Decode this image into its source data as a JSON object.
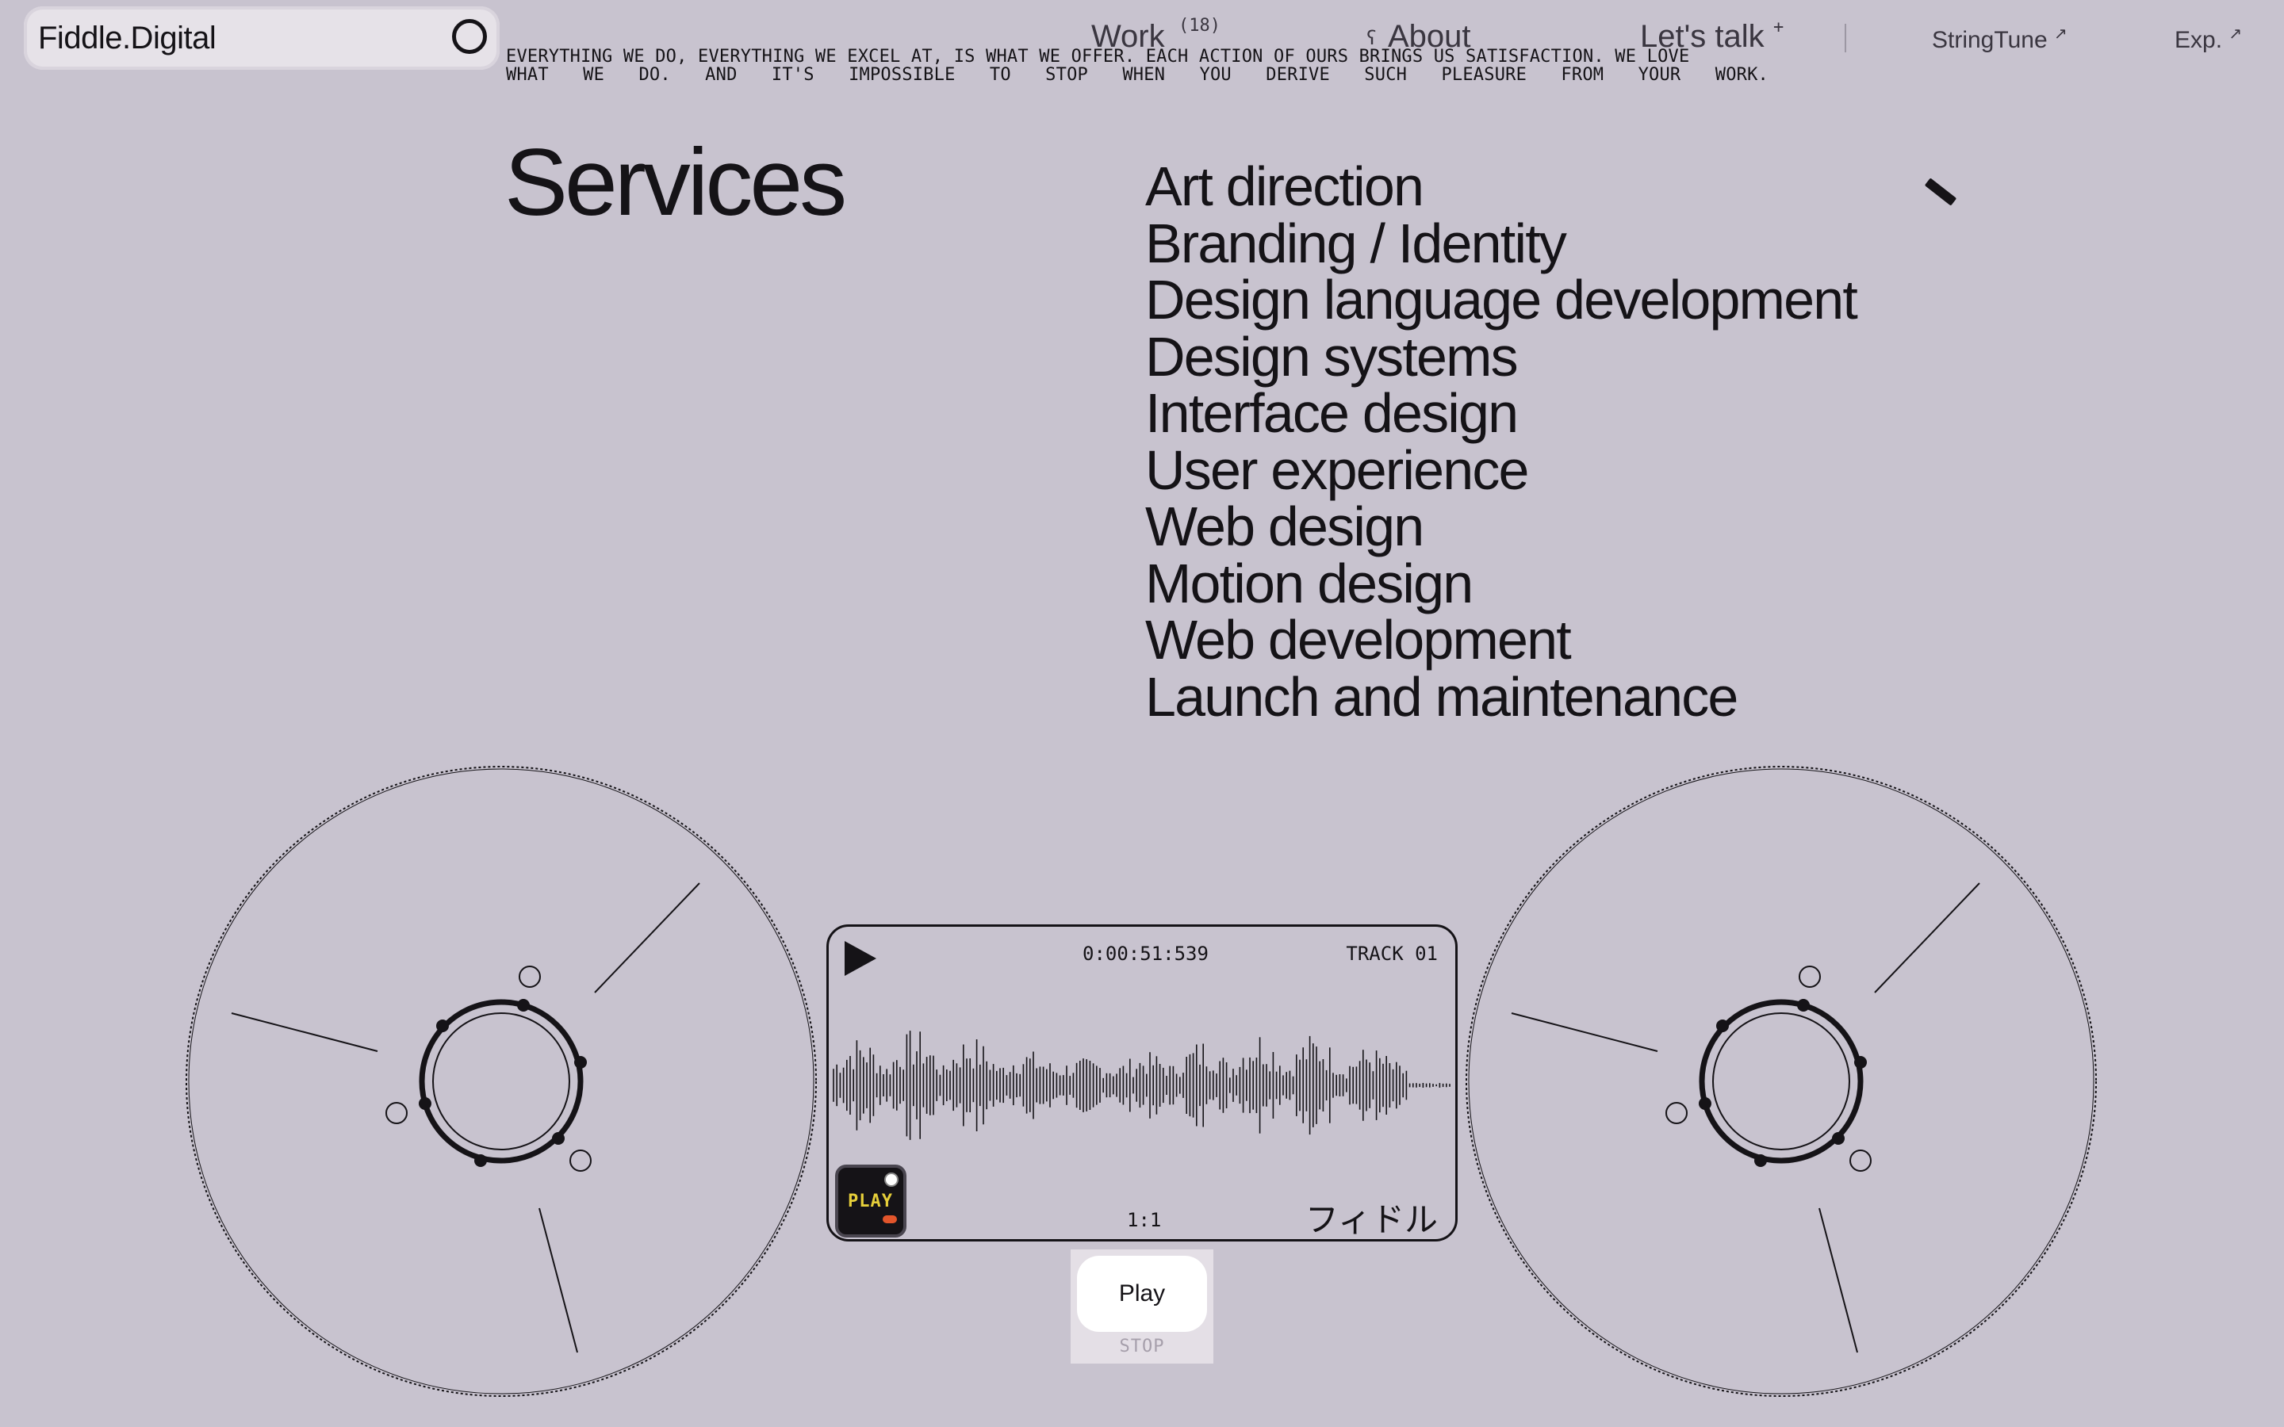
{
  "header": {
    "brand": "Fiddle.Digital",
    "nav": [
      {
        "label": "Work",
        "sup": "(18)"
      },
      {
        "label": "About",
        "prefix": "ʕ"
      },
      {
        "label": "Let's talk",
        "sup": "+"
      }
    ],
    "links": [
      {
        "label": "StringTune",
        "arrow": "↗"
      },
      {
        "label": "Exp.",
        "arrow": "↗"
      }
    ]
  },
  "tagline": {
    "line1": "EVERYTHING WE DO, EVERYTHING WE EXCEL AT, IS WHAT WE OFFER. EACH ACTION OF OURS BRINGS US SATISFACTION. WE LOVE",
    "line2": "WHAT WE DO. AND IT'S IMPOSSIBLE TO STOP WHEN YOU DERIVE SUCH PLEASURE FROM YOUR WORK."
  },
  "services": {
    "title": "Services",
    "items": [
      "Art direction",
      "Branding / Identity",
      "Design language development",
      "Design systems",
      "Interface design",
      "User experience",
      "Web design",
      "Motion design",
      "Web development",
      "Launch and maintenance"
    ]
  },
  "player": {
    "timecode": "0:00:51:539",
    "track": "TRACK 01",
    "ratio": "1:1",
    "badge": "PLAY",
    "japanese": "フィドル",
    "play_label": "Play",
    "stop_label": "STOP"
  },
  "colors": {
    "background": "#c8c3cf",
    "ink": "#151317",
    "pill": "#e6e2e8",
    "badge_text": "#e6cf3a",
    "badge_dot": "#e2552b"
  }
}
